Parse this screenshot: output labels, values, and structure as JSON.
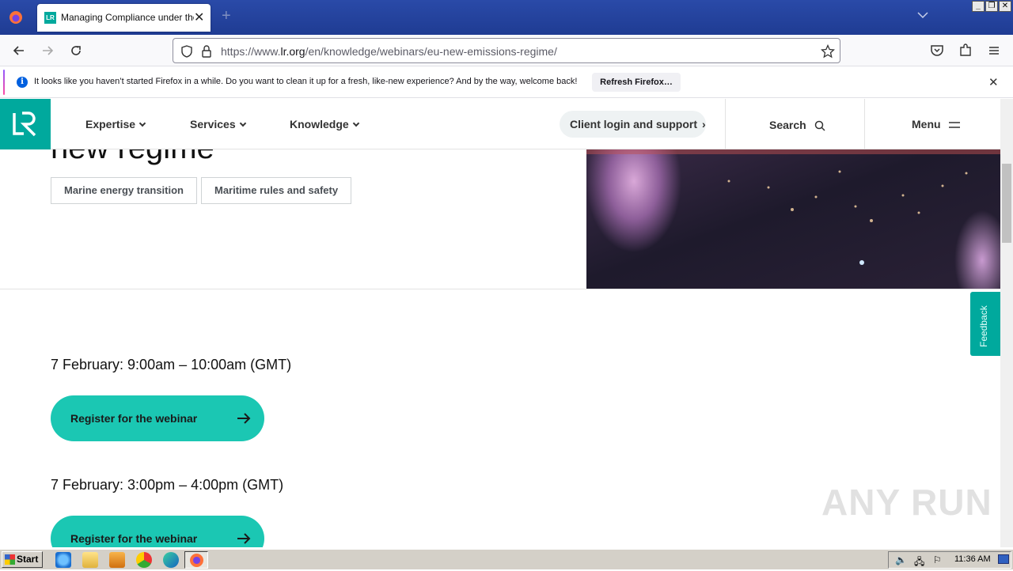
{
  "browser": {
    "tab_title": "Managing Compliance under the EU",
    "url_prefix": "https://www.",
    "url_domain": "lr.org",
    "url_path": "/en/knowledge/webinars/eu-new-emissions-regime/",
    "notification": {
      "message": "It looks like you haven’t started Firefox in a while. Do you want to clean it up for a fresh, like-new experience? And by the way, welcome back!",
      "button": "Refresh Firefox…"
    }
  },
  "site": {
    "nav": {
      "expertise": "Expertise",
      "services": "Services",
      "knowledge": "Knowledge",
      "client_login": "Client login and support",
      "search": "Search",
      "menu": "Menu"
    },
    "hero_title_fragment": "new regime",
    "tags": [
      "Marine energy transition",
      "Maritime rules and safety"
    ],
    "sessions": [
      {
        "date": "7 February: 9:00am – 10:00am (GMT)",
        "button": "Register for the webinar"
      },
      {
        "date": "7 February: 3:00pm – 4:00pm (GMT)",
        "button": "Register for the webinar"
      }
    ],
    "feedback": "Feedback",
    "brand_color": "#00a99d",
    "cta_color": "#1bc7b3"
  },
  "watermark": "ANY RUN",
  "taskbar": {
    "start": "Start",
    "clock": "11:36 AM"
  }
}
